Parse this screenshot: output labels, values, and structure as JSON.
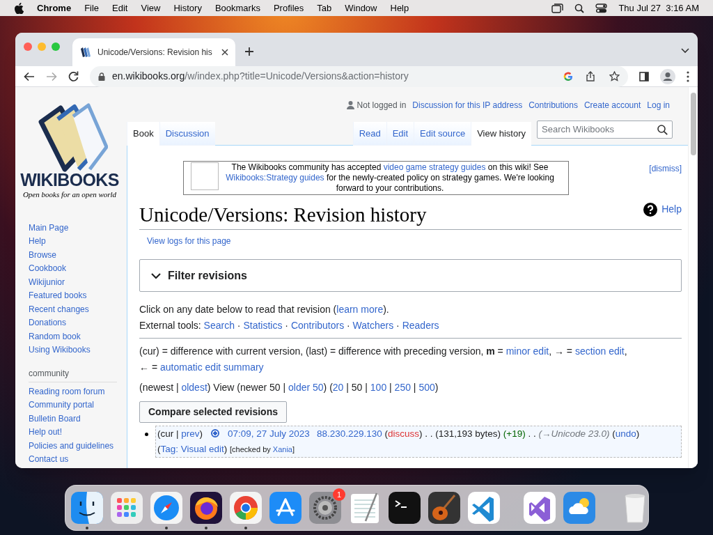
{
  "menubar": {
    "app": "Chrome",
    "items": [
      "File",
      "Edit",
      "View",
      "History",
      "Bookmarks",
      "Profiles",
      "Tab",
      "Window",
      "Help"
    ],
    "clock": "Thu Jul 27  3:16 AM"
  },
  "browser": {
    "tab_title": "Unicode/Versions: Revision his",
    "url_host": "en.wikibooks.org",
    "url_path": "/w/index.php?title=Unicode/Versions&action=history"
  },
  "logo": {
    "wordmark": "WIKIBOOKS",
    "tagline": "Open books for an open world"
  },
  "personal": {
    "status": "Not logged in",
    "links": [
      "Discussion for this IP address",
      "Contributions",
      "Create account",
      "Log in"
    ]
  },
  "page_tabs": [
    {
      "label": "Book",
      "selected": true
    },
    {
      "label": "Discussion",
      "selected": false
    }
  ],
  "view_tabs": [
    {
      "label": "Read",
      "selected": false
    },
    {
      "label": "Edit",
      "selected": false
    },
    {
      "label": "Edit source",
      "selected": false
    },
    {
      "label": "View history",
      "selected": true
    }
  ],
  "search": {
    "placeholder": "Search Wikibooks"
  },
  "sidebar": {
    "items": [
      "Main Page",
      "Help",
      "Browse",
      "Cookbook",
      "Wikijunior",
      "Featured books",
      "Recent changes",
      "Donations",
      "Random book",
      "Using Wikibooks"
    ],
    "community_heading": "community",
    "community_items": [
      "Reading room forum",
      "Community portal",
      "Bulletin Board",
      "Help out!",
      "Policies and guidelines",
      "Contact us"
    ]
  },
  "notice": {
    "segments": [
      {
        "kind": "text",
        "text": "The Wikibooks community has accepted "
      },
      {
        "kind": "link",
        "text": "video game strategy guides"
      },
      {
        "kind": "text",
        "text": " on this wiki! See "
      },
      {
        "kind": "link",
        "text": "Wikibooks:Strategy guides"
      },
      {
        "kind": "text",
        "text": " for the newly-created policy on strategy games. We're looking forward to your contributions."
      }
    ],
    "dismiss": "[dismiss]"
  },
  "heading": "Unicode/Versions: Revision history",
  "help": "Help",
  "view_logs": "View logs for this page",
  "filter": {
    "label": "Filter revisions",
    "expanded": false
  },
  "intro": [
    {
      "kind": "text",
      "text": "Click on any date below to read that revision ("
    },
    {
      "kind": "link",
      "text": "learn more"
    },
    {
      "kind": "text",
      "text": ")."
    }
  ],
  "external_tools": [
    {
      "kind": "text",
      "text": "External tools: "
    },
    {
      "kind": "link",
      "text": "Search"
    },
    {
      "kind": "text",
      "text": " · "
    },
    {
      "kind": "link",
      "text": "Statistics"
    },
    {
      "kind": "text",
      "text": " · "
    },
    {
      "kind": "link",
      "text": "Contributors"
    },
    {
      "kind": "text",
      "text": " · "
    },
    {
      "kind": "link",
      "text": "Watchers"
    },
    {
      "kind": "text",
      "text": " · "
    },
    {
      "kind": "link",
      "text": "Readers"
    }
  ],
  "legend": [
    {
      "kind": "text",
      "text": "(cur) = difference with current version, (last) = difference with preceding version,  "
    },
    {
      "kind": "bold",
      "text": "m"
    },
    {
      "kind": "text",
      "text": " = "
    },
    {
      "kind": "link",
      "text": "minor edit"
    },
    {
      "kind": "text",
      "text": ", → = "
    },
    {
      "kind": "link",
      "text": "section edit"
    },
    {
      "kind": "text",
      "text": ","
    },
    {
      "kind": "break"
    },
    {
      "kind": "text",
      "text": "← = "
    },
    {
      "kind": "link",
      "text": "automatic edit summary"
    }
  ],
  "paging": [
    {
      "kind": "text",
      "text": "(newest | "
    },
    {
      "kind": "link",
      "text": "oldest"
    },
    {
      "kind": "text",
      "text": ") View (newer 50 | "
    },
    {
      "kind": "link",
      "text": "older 50"
    },
    {
      "kind": "text",
      "text": ") ("
    },
    {
      "kind": "link",
      "text": "20"
    },
    {
      "kind": "text",
      "text": " | 50 | "
    },
    {
      "kind": "link",
      "text": "100"
    },
    {
      "kind": "text",
      "text": " | "
    },
    {
      "kind": "link",
      "text": "250"
    },
    {
      "kind": "text",
      "text": " | "
    },
    {
      "kind": "link",
      "text": "500"
    },
    {
      "kind": "text",
      "text": ")"
    }
  ],
  "compare_button": "Compare selected revisions",
  "revisions": [
    {
      "selected": true,
      "segments": [
        {
          "kind": "text",
          "text": "(cur | "
        },
        {
          "kind": "link",
          "text": "prev"
        },
        {
          "kind": "text",
          "text": ")"
        },
        {
          "kind": "radio"
        },
        {
          "kind": "link",
          "text": "07:09, 27 July 2023"
        },
        {
          "kind": "gaplink",
          "text": "88.230.229.130"
        },
        {
          "kind": "text",
          "text": " ("
        },
        {
          "kind": "redlink",
          "text": "discuss"
        },
        {
          "kind": "text",
          "text": ")  . . (131,193 bytes) "
        },
        {
          "kind": "green",
          "text": "(+19)"
        },
        {
          "kind": "text",
          "text": " . . "
        },
        {
          "kind": "italic",
          "text": "(→Unicode 23.0)"
        },
        {
          "kind": "text",
          "text": " ("
        },
        {
          "kind": "link",
          "text": "undo"
        },
        {
          "kind": "text",
          "text": ")"
        },
        {
          "kind": "break"
        },
        {
          "kind": "text",
          "text": "("
        },
        {
          "kind": "link",
          "text": "Tag: Visual edit"
        },
        {
          "kind": "text",
          "text": ") "
        },
        {
          "kind": "small",
          "text": "[checked by "
        },
        {
          "kind": "smalllink",
          "text": "Xania"
        },
        {
          "kind": "small",
          "text": "]"
        }
      ]
    }
  ],
  "dock": [
    {
      "kind": "finder",
      "running": true
    },
    {
      "kind": "launchpad",
      "running": false
    },
    {
      "kind": "safari",
      "running": true
    },
    {
      "kind": "firefox",
      "running": true
    },
    {
      "kind": "chrome",
      "running": true
    },
    {
      "kind": "appstore",
      "running": false
    },
    {
      "kind": "settings",
      "running": false,
      "badge": "1"
    },
    {
      "kind": "textedit",
      "running": false
    },
    {
      "kind": "terminal",
      "running": false
    },
    {
      "kind": "guitar",
      "running": false
    },
    {
      "kind": "vscode",
      "running": false
    },
    {
      "kind": "separator"
    },
    {
      "kind": "visualstudio",
      "running": false
    },
    {
      "kind": "weather",
      "running": false
    },
    {
      "kind": "separator"
    },
    {
      "kind": "trash",
      "running": false
    }
  ]
}
